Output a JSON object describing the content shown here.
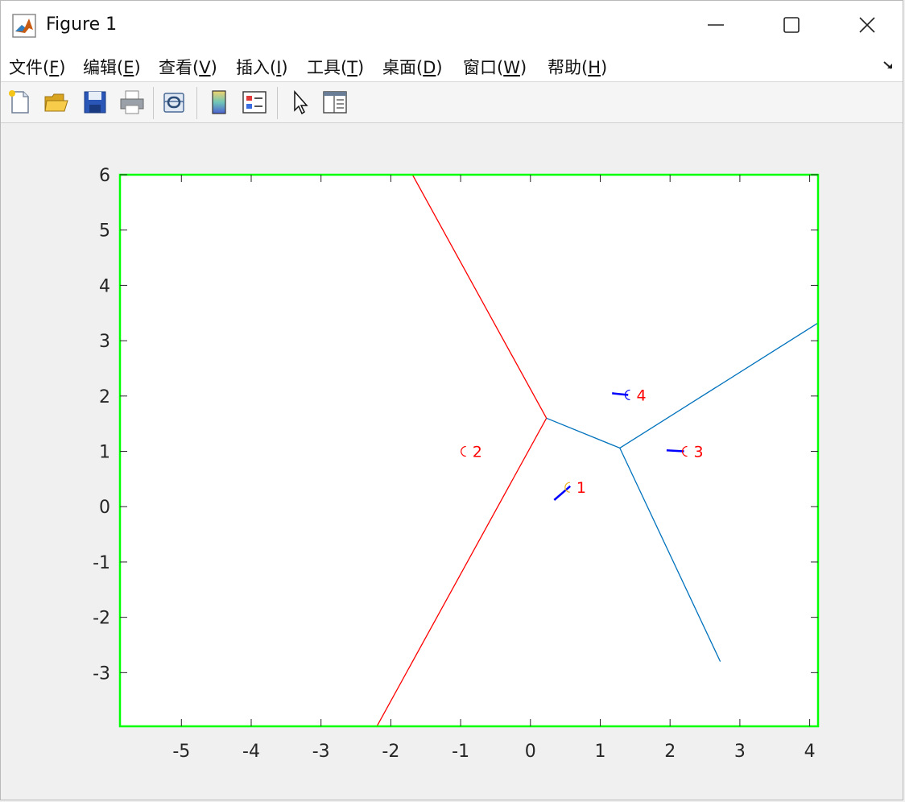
{
  "window": {
    "title": "Figure 1",
    "icon": "matlab-logo-icon",
    "controls": [
      "minimize-icon",
      "maximize-icon",
      "close-icon"
    ]
  },
  "menu": {
    "items": [
      {
        "label": "文件(F)",
        "key": "F"
      },
      {
        "label": "编辑(E)",
        "key": "E"
      },
      {
        "label": "查看(V)",
        "key": "V"
      },
      {
        "label": "插入(I)",
        "key": "I"
      },
      {
        "label": "工具(T)",
        "key": "T"
      },
      {
        "label": "桌面(D)",
        "key": "D"
      },
      {
        "label": "窗口(W)",
        "key": "W"
      },
      {
        "label": "帮助(H)",
        "key": "H"
      }
    ]
  },
  "toolbar": {
    "buttons": [
      "new-figure-icon",
      "open-file-icon",
      "save-icon",
      "print-icon",
      "link-icon",
      "colorbar-icon",
      "legend-icon",
      "pointer-icon",
      "property-inspector-icon"
    ]
  },
  "chart_data": {
    "type": "line",
    "title": "",
    "xlabel": "",
    "ylabel": "",
    "xlim": [
      -5.88,
      4.12
    ],
    "ylim": [
      -3.97,
      6.0
    ],
    "xticks": [
      -5,
      -4,
      -3,
      -2,
      -1,
      0,
      1,
      2,
      3,
      4
    ],
    "yticks": [
      -3,
      -2,
      -1,
      0,
      1,
      2,
      3,
      4,
      5,
      6
    ],
    "box_color": "#00ff00",
    "grid": false,
    "series": [
      {
        "color": "#ff0000",
        "x": [
          -1.69,
          0.23
        ],
        "y": [
          6.0,
          1.6
        ]
      },
      {
        "color": "#ff0000",
        "x": [
          0.23,
          -2.2
        ],
        "y": [
          1.6,
          -3.97
        ]
      },
      {
        "color": "#0072bd",
        "x": [
          0.23,
          1.28
        ],
        "y": [
          1.6,
          1.06
        ]
      },
      {
        "color": "#0072bd",
        "x": [
          1.28,
          4.12
        ],
        "y": [
          1.06,
          3.32
        ]
      },
      {
        "color": "#0072bd",
        "x": [
          1.28,
          2.72
        ],
        "y": [
          1.06,
          -2.8
        ]
      },
      {
        "color": "#0000ff",
        "x": [
          0.34,
          0.57
        ],
        "y": [
          0.12,
          0.37
        ]
      },
      {
        "color": "#0000ff",
        "x": [
          1.95,
          2.2
        ],
        "y": [
          1.02,
          1.0
        ]
      },
      {
        "color": "#0000ff",
        "x": [
          1.17,
          1.4
        ],
        "y": [
          2.05,
          2.02
        ]
      }
    ],
    "points": [
      {
        "label": "1",
        "x": 0.52,
        "y": 0.35,
        "marker_color": "#edb120"
      },
      {
        "label": "2",
        "x": -0.97,
        "y": 1.0,
        "marker_color": "#ff0000"
      },
      {
        "label": "3",
        "x": 2.2,
        "y": 1.0,
        "marker_color": "#ff0000"
      },
      {
        "label": "4",
        "x": 1.38,
        "y": 2.02,
        "marker_color": "#0000ff"
      }
    ]
  }
}
